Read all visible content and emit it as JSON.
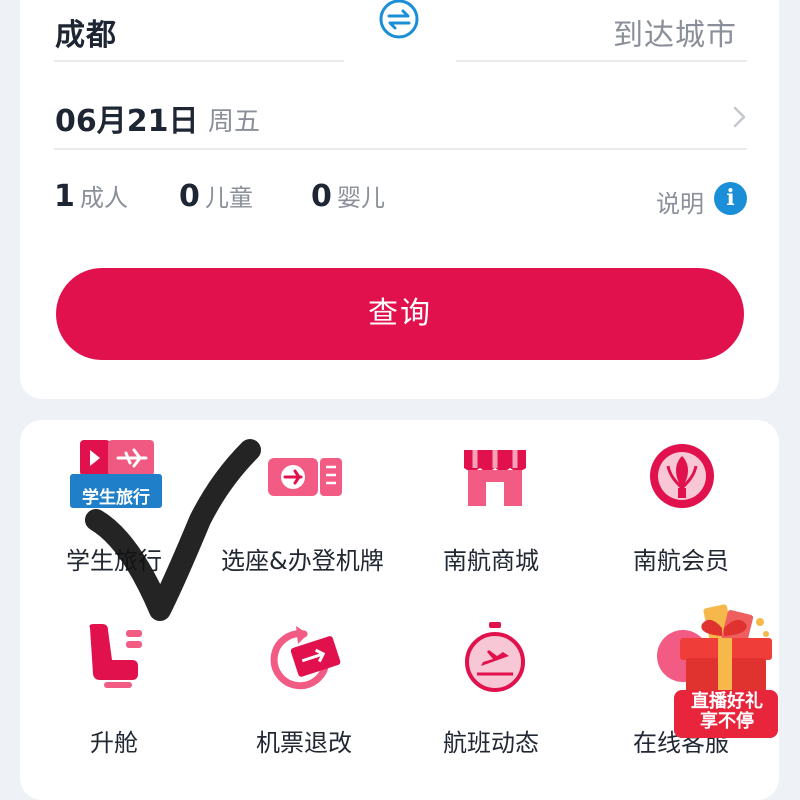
{
  "route": {
    "from": "成都",
    "to": "到达城市"
  },
  "date": {
    "value": "06月21日",
    "weekday": "周五"
  },
  "passengers": [
    {
      "count": "1",
      "label": "成人"
    },
    {
      "count": "0",
      "label": "儿童"
    },
    {
      "count": "0",
      "label": "婴儿"
    }
  ],
  "info": {
    "label": "说明",
    "icon": "info-icon"
  },
  "search": {
    "label": "查询"
  },
  "services": [
    {
      "label": "学生旅行",
      "badge": "学生旅行",
      "icon": "student-travel-icon"
    },
    {
      "label": "选座&办登机牌",
      "icon": "boarding-pass-icon"
    },
    {
      "label": "南航商城",
      "icon": "shop-icon"
    },
    {
      "label": "南航会员",
      "icon": "member-icon"
    },
    {
      "label": "升舱",
      "icon": "seat-upgrade-icon"
    },
    {
      "label": "机票退改",
      "icon": "refund-change-icon"
    },
    {
      "label": "航班动态",
      "icon": "flight-status-icon"
    },
    {
      "label": "在线客服",
      "icon": "customer-service-icon"
    }
  ],
  "promo": {
    "line1": "直播好礼",
    "line2": "享不停",
    "icon": "gift-box-icon"
  },
  "colors": {
    "accent": "#e1114d",
    "info": "#1a8fd8",
    "text": "#1e2533",
    "muted": "#8a8f99"
  }
}
